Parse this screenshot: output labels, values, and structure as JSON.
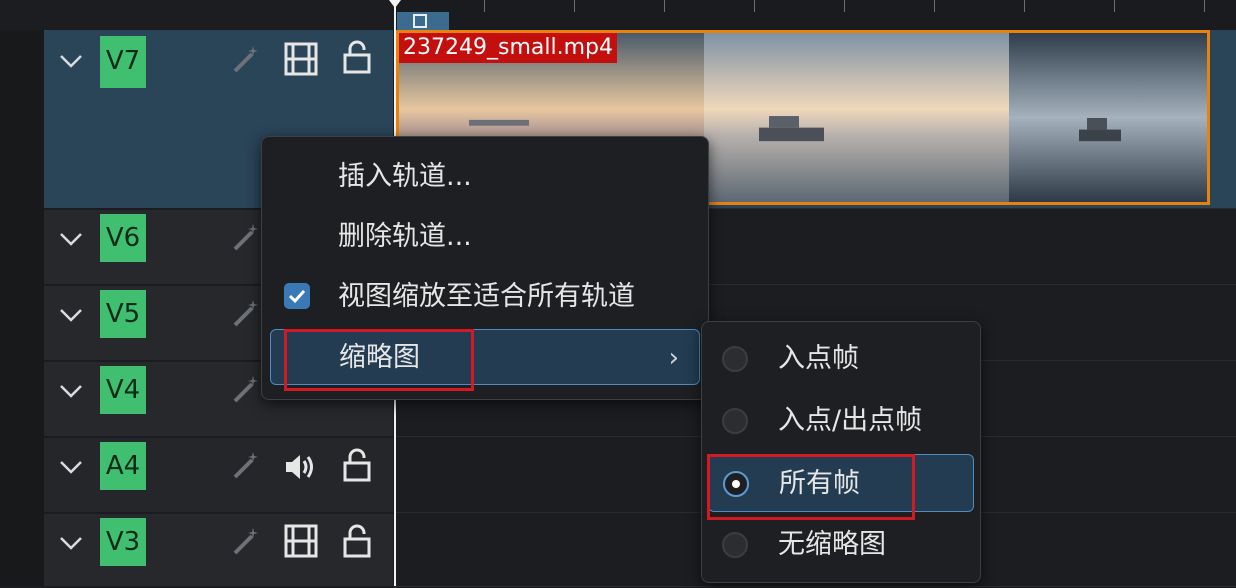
{
  "clip": {
    "name": "237249_small.mp4"
  },
  "tracks": [
    {
      "id": "V7",
      "type": "video",
      "selected": true,
      "icons": [
        "chevron-down-icon",
        "magic-wand-icon",
        "film-icon",
        "lock-icon"
      ]
    },
    {
      "id": "V6",
      "type": "video",
      "selected": false
    },
    {
      "id": "V5",
      "type": "video",
      "selected": false
    },
    {
      "id": "V4",
      "type": "video",
      "selected": false
    },
    {
      "id": "A4",
      "type": "audio",
      "selected": false,
      "icons": [
        "chevron-down-icon",
        "magic-wand-icon",
        "speaker-icon",
        "lock-icon"
      ]
    },
    {
      "id": "V3",
      "type": "video",
      "selected": false
    }
  ],
  "context_menu": {
    "items": [
      {
        "label": "插入轨道..."
      },
      {
        "label": "删除轨道..."
      },
      {
        "label": "视图缩放至适合所有轨道",
        "checked": true
      },
      {
        "label": "缩略图",
        "submenu_arrow": "›",
        "highlighted": true
      }
    ]
  },
  "thumbnail_submenu": {
    "options": [
      {
        "label": "入点帧",
        "selected": false
      },
      {
        "label": "入点/出点帧",
        "selected": false
      },
      {
        "label": "所有帧",
        "selected": true
      },
      {
        "label": "无缩略图",
        "selected": false
      }
    ]
  },
  "colors": {
    "track_tag": "#3fbf6f",
    "selected_track": "#2a4458",
    "clip_border": "#e8820e",
    "clip_label_bg": "#c40f0f",
    "highlight_border": "#4e8cc1",
    "annotation_box": "#d31a22"
  }
}
